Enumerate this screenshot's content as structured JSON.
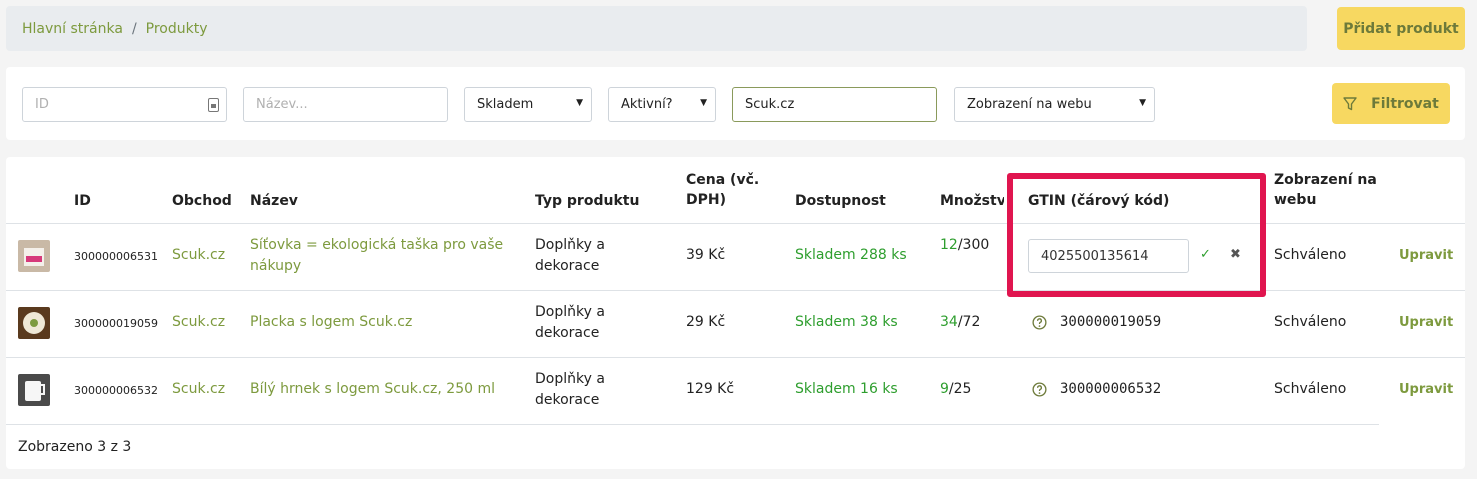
{
  "breadcrumb": {
    "home": "Hlavní stránka",
    "separator": "/",
    "current": "Produkty"
  },
  "header": {
    "add_product_label": "Přidat produkt"
  },
  "filters": {
    "id_placeholder": "ID",
    "name_placeholder": "Název...",
    "stock_value": "Skladem",
    "active_value": "Aktivní?",
    "shop_value": "Scuk.cz",
    "web_display_value": "Zobrazení na webu",
    "filter_button_label": "Filtrovat"
  },
  "table": {
    "columns": {
      "id": "ID",
      "shop": "Obchod",
      "name": "Název",
      "type": "Typ produktu",
      "price_line1": "Cena (vč.",
      "price_line2": "DPH)",
      "availability": "Dostupnost",
      "quantity": "Množství",
      "gtin": "GTIN (čárový kód)",
      "web_line1": "Zobrazení na",
      "web_line2": "webu"
    },
    "rows": [
      {
        "id": "300000006531",
        "shop": "Scuk.cz",
        "name_line1": "Síťovka = ekologická taška pro vaše",
        "name_line2": "nákupy",
        "type_line1": "Doplňky a",
        "type_line2": "dekorace",
        "price": "39 Kč",
        "availability": "Skladem 288 ks",
        "qty_available": "12",
        "qty_total": "/300",
        "gtin": "4025500135614",
        "web_status": "Schváleno",
        "edit_label": "Upravit"
      },
      {
        "id": "300000019059",
        "shop": "Scuk.cz",
        "name_line1": "Placka s logem Scuk.cz",
        "name_line2": "",
        "type_line1": "Doplňky a",
        "type_line2": "dekorace",
        "price": "29 Kč",
        "availability": "Skladem 38 ks",
        "qty_available": "34",
        "qty_total": "/72",
        "gtin": "300000019059",
        "web_status": "Schváleno",
        "edit_label": "Upravit"
      },
      {
        "id": "300000006532",
        "shop": "Scuk.cz",
        "name_line1": "Bílý hrnek s logem Scuk.cz, 250 ml",
        "name_line2": "",
        "type_line1": "Doplňky a",
        "type_line2": "dekorace",
        "price": "129 Kč",
        "availability": "Skladem 16 ks",
        "qty_available": "9",
        "qty_total": "/25",
        "gtin": "300000006532",
        "web_status": "Schváleno",
        "edit_label": "Upravit"
      }
    ],
    "footer": "Zobrazeno 3 z 3"
  },
  "icons": {
    "confirm": "check-icon",
    "cancel": "close-icon",
    "help": "question-circle-icon",
    "filter": "funnel-icon"
  },
  "colors": {
    "accent_green": "#7d9a3e",
    "stock_green": "#2e9e2e",
    "button_yellow": "#f7d861",
    "highlight": "#e0154f"
  }
}
